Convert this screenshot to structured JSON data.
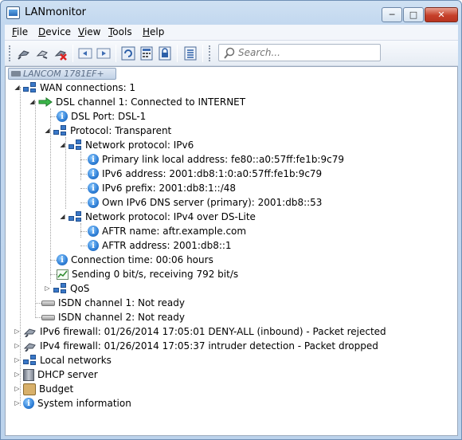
{
  "window": {
    "title": "LANmonitor",
    "minimize_label": "─",
    "maximize_label": "□",
    "close_label": "✕"
  },
  "menu": [
    {
      "label": "File",
      "key": "F",
      "rest": "ile"
    },
    {
      "label": "Device",
      "key": "D",
      "rest": "evice"
    },
    {
      "label": "View",
      "key": "V",
      "rest": "iew"
    },
    {
      "label": "Tools",
      "key": "T",
      "rest": "ools"
    },
    {
      "label": "Help",
      "key": "H",
      "rest": "elp"
    }
  ],
  "toolbar": {
    "icons": [
      "add-device-icon",
      "edit-device-icon",
      "delete-device-icon",
      "back-icon",
      "forward-icon",
      "refresh-icon",
      "calculator-icon",
      "lock-icon",
      "list-icon"
    ],
    "search_placeholder": "Search..."
  },
  "device_chip": "LANCOM 1781EF+",
  "tree": {
    "wan": "WAN connections: 1",
    "dsl_channel": "DSL channel 1: Connected to INTERNET",
    "dsl_port": "DSL Port: DSL-1",
    "protocol": "Protocol: Transparent",
    "net_ipv6": "Network protocol: IPv6",
    "primary_link": "Primary link local address: fe80::a0:57ff:fe1b:9c79",
    "ipv6_address": "IPv6 address: 2001:db8:1:0:a0:57ff:fe1b:9c79",
    "ipv6_prefix": "IPv6 prefix: 2001:db8:1::/48",
    "own_dns": "Own IPv6 DNS server (primary): 2001:db8::53",
    "net_ipv4": "Network protocol: IPv4 over DS-Lite",
    "aftr_name": "AFTR name: aftr.example.com",
    "aftr_address": "AFTR address: 2001:db8::1",
    "connection_time": "Connection time: 00:06 hours",
    "traffic": "Sending 0 bit/s, receiving 792 bit/s",
    "qos": "QoS",
    "isdn1": "ISDN channel 1: Not ready",
    "isdn2": "ISDN channel 2: Not ready",
    "ipv6_firewall": "IPv6 firewall: 01/26/2014 17:05:01 DENY-ALL (inbound) - Packet rejected",
    "ipv4_firewall": "IPv4 firewall: 01/26/2014 17:05:37 intruder detection - Packet dropped",
    "local_networks": "Local networks",
    "dhcp": "DHCP server",
    "budget": "Budget",
    "system_info": "System information"
  },
  "colors": {
    "tree_line": "#a0a0a0",
    "info_blue": "#2f7fd6",
    "arrow_green": "#3cb64a"
  }
}
